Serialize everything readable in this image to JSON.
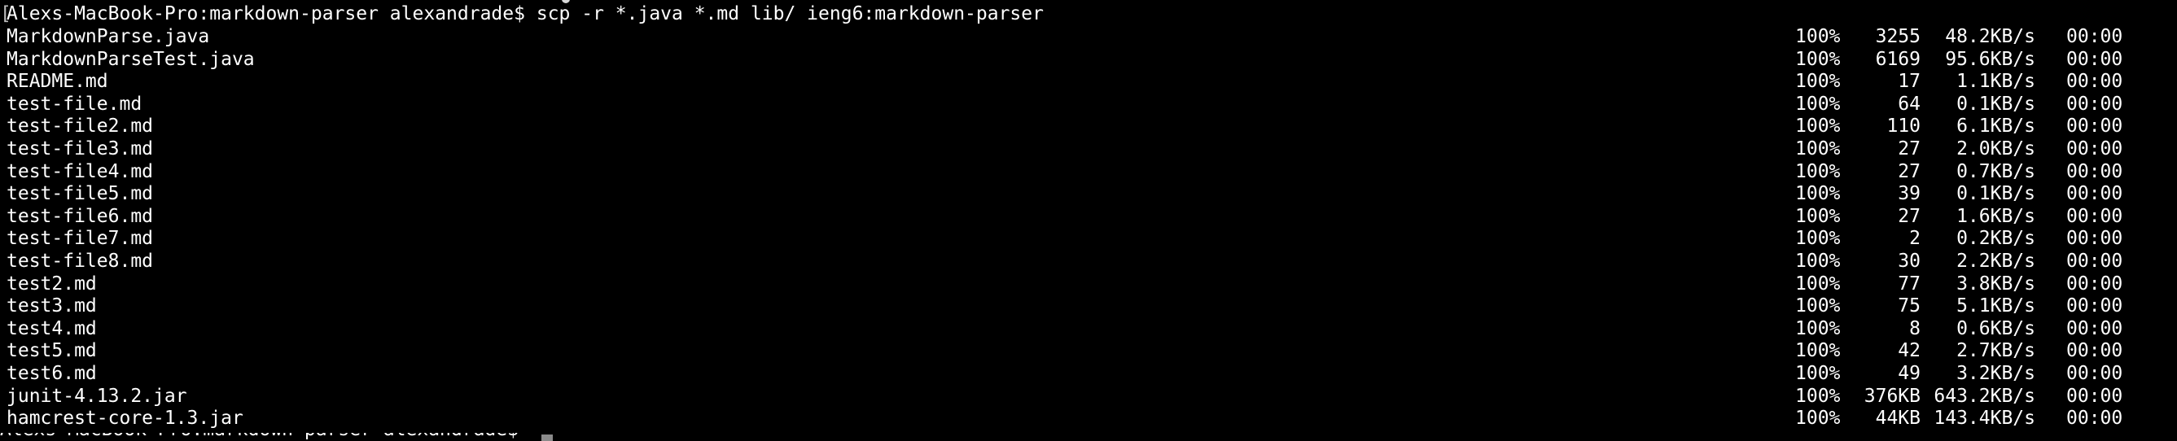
{
  "terminal": {
    "prompt": "Alexs-MacBook-Pro:markdown-parser alexandrade$",
    "command": "scp -r *.java *.md lib/ ieng6:markdown-parser",
    "transfers": [
      {
        "file": "MarkdownParse.java",
        "percent": "100%",
        "size": "3255",
        "rate": "48.2KB/s",
        "eta": "00:00"
      },
      {
        "file": "MarkdownParseTest.java",
        "percent": "100%",
        "size": "6169",
        "rate": "95.6KB/s",
        "eta": "00:00"
      },
      {
        "file": "README.md",
        "percent": "100%",
        "size": "17",
        "rate": "1.1KB/s",
        "eta": "00:00"
      },
      {
        "file": "test-file.md",
        "percent": "100%",
        "size": "64",
        "rate": "0.1KB/s",
        "eta": "00:00"
      },
      {
        "file": "test-file2.md",
        "percent": "100%",
        "size": "110",
        "rate": "6.1KB/s",
        "eta": "00:00"
      },
      {
        "file": "test-file3.md",
        "percent": "100%",
        "size": "27",
        "rate": "2.0KB/s",
        "eta": "00:00"
      },
      {
        "file": "test-file4.md",
        "percent": "100%",
        "size": "27",
        "rate": "0.7KB/s",
        "eta": "00:00"
      },
      {
        "file": "test-file5.md",
        "percent": "100%",
        "size": "39",
        "rate": "0.1KB/s",
        "eta": "00:00"
      },
      {
        "file": "test-file6.md",
        "percent": "100%",
        "size": "27",
        "rate": "1.6KB/s",
        "eta": "00:00"
      },
      {
        "file": "test-file7.md",
        "percent": "100%",
        "size": "2",
        "rate": "0.2KB/s",
        "eta": "00:00"
      },
      {
        "file": "test-file8.md",
        "percent": "100%",
        "size": "30",
        "rate": "2.2KB/s",
        "eta": "00:00"
      },
      {
        "file": "test2.md",
        "percent": "100%",
        "size": "77",
        "rate": "3.8KB/s",
        "eta": "00:00"
      },
      {
        "file": "test3.md",
        "percent": "100%",
        "size": "75",
        "rate": "5.1KB/s",
        "eta": "00:00"
      },
      {
        "file": "test4.md",
        "percent": "100%",
        "size": "8",
        "rate": "0.6KB/s",
        "eta": "00:00"
      },
      {
        "file": "test5.md",
        "percent": "100%",
        "size": "42",
        "rate": "2.7KB/s",
        "eta": "00:00"
      },
      {
        "file": "test6.md",
        "percent": "100%",
        "size": "49",
        "rate": "3.2KB/s",
        "eta": "00:00"
      },
      {
        "file": "junit-4.13.2.jar",
        "percent": "100%",
        "size": "376KB",
        "rate": "643.2KB/s",
        "eta": "00:00"
      },
      {
        "file": "hamcrest-core-1.3.jar",
        "percent": "100%",
        "size": "44KB",
        "rate": "143.4KB/s",
        "eta": "00:00"
      }
    ],
    "next_prompt": "Alexs-MacBook-Pro:markdown-parser alexandrade$",
    "colors": {
      "background": "#000000",
      "foreground": "#ffffff",
      "cursor": "#8a8a8a"
    }
  }
}
